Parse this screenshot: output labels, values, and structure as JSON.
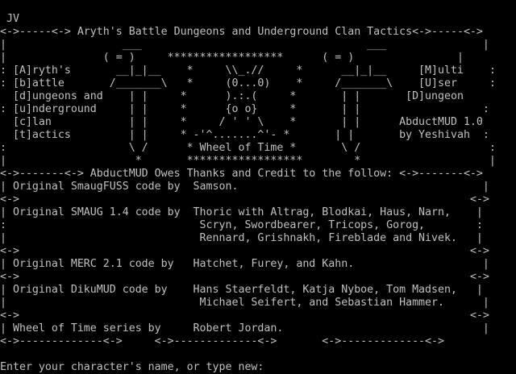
{
  "terminal": {
    "lines": [
      " JV",
      "<->-----<-> Aryth's Battle Dungeons and Underground Clan Tactics<->-----<->",
      "|                  ___                                   ___               |",
      "|               ( = )     ******************      ( = )                |",
      ": [A]ryth's       __|_|__    *     \\\\_.//     *      __|_|__     [M]ulti    :",
      ": [b]attle       /_______\\   *     (0...0)    *     /_______\\    [U]ser     :",
      "  [d]ungeons and    | |     *      ).:.(     *       | |       [D]ungeon   ",
      ": [u]nderground     | |     *      {o o}     *       | |                   :",
      "  [c]lan            | |     *     / ' ' \\    *       | |      AbductMUD 1.0",
      "  [t]actics         | |     * -'^.......^'- *       | |       by Yeshivah  :",
      ":                   \\ /      * Wheel of Time *       \\ /                    :",
      "|                    *       ******************        *                    |",
      "<->-------<-> AbductMUD Owes Thanks and Credit to the follow: <->-------<->",
      "| Original SmaugFUSS code by  Samson.                                      |",
      "<->                                                                      <->",
      "| Original SMAUG 1.4 code by  Thoric with Altrag, Blodkai, Haus, Narn,    |",
      ":                              Scryn, Swordbearer, Tricops, Gorog,        :",
      "|                              Rennard, Grishnakh, Fireblade and Nivek.   |",
      "<->                                                                      <->",
      "| Original MERC 2.1 code by   Hatchet, Furey, and Kahn.                    |",
      "<->                                                                      <->",
      "| Original DikuMUD code by    Hans Staerfeldt, Katja Nyboe, Tom Madsen,   |",
      "|                              Michael Seifert, and Sebastian Hammer.      |",
      "<->                                                                      <->",
      "| Wheel of Time series by     Robert Jordan.                               |",
      "<->-------------<->     <->-------------<->       <->-------------<->",
      "",
      "Enter your character's name, or type new:"
    ]
  }
}
